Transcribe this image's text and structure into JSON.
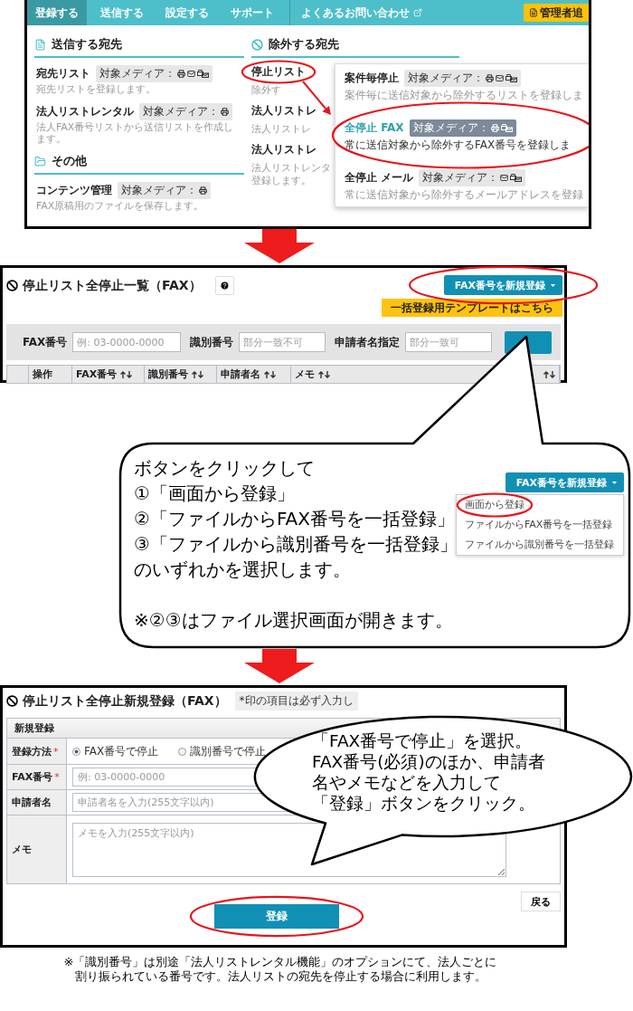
{
  "nav": {
    "items": [
      {
        "label": "登録する",
        "selected": true
      },
      {
        "label": "送信する",
        "selected": false
      },
      {
        "label": "設定する",
        "selected": false
      },
      {
        "label": "サポート",
        "selected": false
      }
    ],
    "faq_link": "よくあるお問い合わせ",
    "admin_button": "管理者追"
  },
  "menu": {
    "sections_left": [
      {
        "title": "送信する宛先",
        "kind": "send",
        "items": [
          {
            "title": "宛先リスト",
            "media_label": "対象メディア：",
            "media": [
              {
                "kind": "print"
              },
              {
                "kind": "mail"
              },
              {
                "kind": "faxmail"
              }
            ],
            "desc": "宛先リストを登録します。"
          },
          {
            "title": "法人リストレンタル",
            "media_label": "対象メディア：",
            "media": [
              {
                "kind": "print"
              }
            ],
            "desc": "法人FAX番号リストから送信リストを作成します。"
          }
        ]
      },
      {
        "title": "その他",
        "kind": "other",
        "items": [
          {
            "title": "コンテンツ管理",
            "media_label": "対象メディア：",
            "media": [
              {
                "kind": "print"
              }
            ],
            "desc": "FAX原稿用のファイルを保存します。"
          }
        ]
      }
    ],
    "section_right": {
      "title": "除外する宛先",
      "kind": "exclude",
      "items": [
        {
          "title": "停止リスト",
          "highlighted": true,
          "desc": "除外す"
        },
        {
          "title": "法人リストレ",
          "highlighted": false,
          "desc": "法人リストレ"
        },
        {
          "title": "法人リストレ",
          "highlighted": false,
          "desc": "法人リストレンタ",
          "desc_more": "登録します。"
        }
      ]
    },
    "submenu": [
      {
        "title": "案件毎停止",
        "selected": false,
        "media_label": "対象メディア：",
        "media": [
          {
            "kind": "print"
          },
          {
            "kind": "mail"
          },
          {
            "kind": "faxmail"
          }
        ],
        "desc": "案件毎に送信対象から除外するリストを登録しま"
      },
      {
        "title": "全停止 FAX",
        "selected": true,
        "media_label": "対象メディア：",
        "media": [
          {
            "kind": "print"
          },
          {
            "kind": "faxmail"
          }
        ],
        "desc": "常に送信対象から除外するFAX番号を登録しま"
      },
      {
        "title": "全停止 メール",
        "selected": false,
        "media_label": "対象メディア：",
        "media": [
          {
            "kind": "mail"
          },
          {
            "kind": "faxmail"
          }
        ],
        "desc": "常に送信対象から除外するメールアドレスを登録"
      }
    ]
  },
  "list_screen": {
    "title": "停止リスト全停止一覧（FAX）",
    "new_button": "FAX番号を新規登録",
    "template_button": "一括登録用テンプレートはこちら",
    "filters": [
      {
        "label": "FAX番号",
        "placeholder": "例: 03-0000-0000"
      },
      {
        "label": "識別番号",
        "placeholder": "部分一致不可"
      },
      {
        "label": "申請者名指定",
        "placeholder": "部分一致可"
      }
    ],
    "columns": [
      {
        "label": "操作",
        "sortable": false
      },
      {
        "label": "FAX番号",
        "sortable": true
      },
      {
        "label": "識別番号",
        "sortable": true
      },
      {
        "label": "申請者名",
        "sortable": true
      },
      {
        "label": "メモ",
        "sortable": true
      },
      {
        "sortable": true
      }
    ]
  },
  "callout_1": {
    "lines": [
      "ボタンをクリックして",
      "①「画面から登録」",
      "②「ファイルからFAX番号を一括登録」",
      "③「ファイルから識別番号を一括登録」",
      "のいずれかを選択します。"
    ],
    "note": "※②③はファイル選択画面が開きます。",
    "button": "FAX番号を新規登録",
    "menu": [
      {
        "label": "画面から登録",
        "highlighted": true
      },
      {
        "label": "ファイルからFAX番号を一括登録",
        "highlighted": false
      },
      {
        "label": "ファイルから識別番号を一括登録",
        "highlighted": false
      }
    ]
  },
  "form_screen": {
    "title": "停止リスト全停止新規登録（FAX）",
    "note": "*印の項目は必ず入力し",
    "section": "新規登録",
    "rows": [
      {
        "kind": "radio",
        "label": "登録方法",
        "required_mark": "*",
        "options": [
          {
            "label": "FAX番号で停止",
            "selected": true
          },
          {
            "label": "識別番号で停止",
            "selected": false
          }
        ]
      },
      {
        "kind": "input",
        "label": "FAX番号",
        "required_mark": "*",
        "placeholder": "例: 03-0000-0000"
      },
      {
        "kind": "input",
        "label": "申請者名",
        "placeholder": "申請者名を入力(255文字以内)"
      },
      {
        "kind": "textarea",
        "label": "メモ",
        "placeholder": "メモを入力(255文字以内)"
      }
    ],
    "submit_button": "登録",
    "back_button": "戻る"
  },
  "callout_2": {
    "lines": [
      "「FAX番号で停止」を選択。",
      "FAX番号(必須)のほか、申請者",
      "名やメモなどを入力して",
      "「登録」ボタンをクリック。"
    ]
  },
  "footnote": {
    "lines": [
      "※「識別番号」は別途「法人リストレンタル機能」のオプションにて、法人ごとに",
      "割り振られている番号です。法人リストの宛先を停止する場合に利用します。"
    ]
  }
}
